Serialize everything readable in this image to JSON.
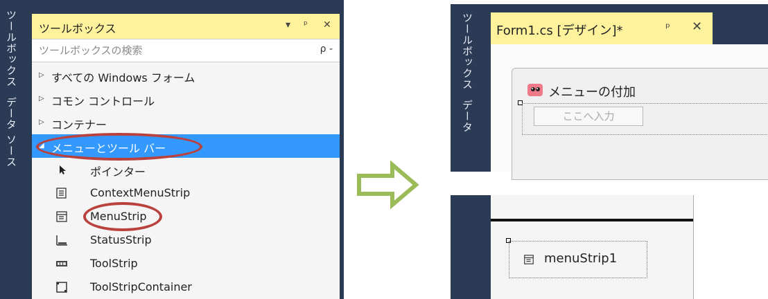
{
  "left": {
    "side_tabs": [
      "ツールボックス",
      "データ ソース"
    ],
    "toolbox": {
      "title": "ツールボックス",
      "header_buttons": [
        "▾",
        "ᵖ",
        "✕"
      ],
      "search_placeholder": "ツールボックスの検索",
      "search_icon": "ρ -"
    },
    "categories": [
      {
        "label": "すべての Windows フォーム",
        "expander": "▷"
      },
      {
        "label": "コモン コントロール",
        "expander": "▷"
      },
      {
        "label": "コンテナー",
        "expander": "▷"
      },
      {
        "label": "メニューとツール バー",
        "expander": "◢"
      }
    ],
    "items": [
      {
        "label": "ポインター",
        "icon": "pointer-icon"
      },
      {
        "label": "ContextMenuStrip",
        "icon": "context-menu-strip-icon"
      },
      {
        "label": "MenuStrip",
        "icon": "menu-strip-icon"
      },
      {
        "label": "StatusStrip",
        "icon": "status-strip-icon"
      },
      {
        "label": "ToolStrip",
        "icon": "tool-strip-icon"
      },
      {
        "label": "ToolStripContainer",
        "icon": "tool-strip-container-icon"
      }
    ]
  },
  "right_top": {
    "side_tabs": [
      "ツールボックス",
      "データ"
    ],
    "tab_title": "Form1.cs [デザイン]*",
    "tab_pin": "ᵖ",
    "tab_close": "✕",
    "form_title": "メニューの付加",
    "type_here": "ここへ入力"
  },
  "right_bottom": {
    "tray_label": "menuStrip1"
  },
  "colors": {
    "panel_dark": "#2b3a55",
    "header_yellow": "#fff29d",
    "selection_blue": "#3399ff",
    "annotation_red": "#b9423e",
    "arrow_green": "#9bbb59"
  }
}
